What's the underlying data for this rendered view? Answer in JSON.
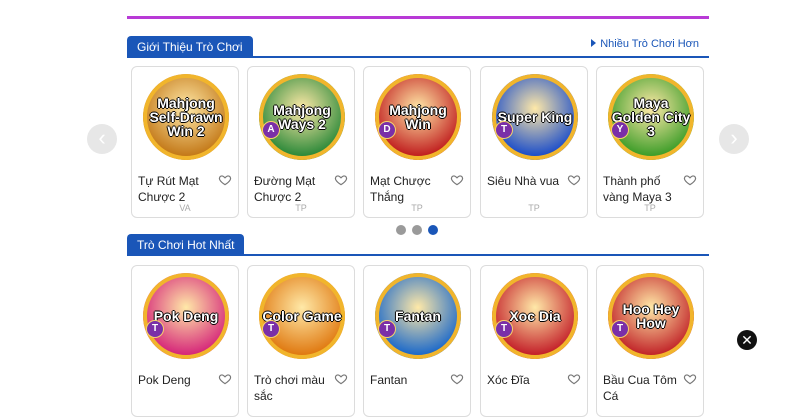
{
  "section1": {
    "title": "Giới Thiệu Trò Chơi",
    "more_label": "Nhiều Trò Chơi Hơn"
  },
  "section2": {
    "title": "Trò Chơi Hot Nhất"
  },
  "games_row1": [
    {
      "name": "Tự Rút Mạt Chược 2",
      "provider": "VA",
      "logo": "Mahjong Self-Drawn Win 2",
      "badge": "",
      "color": "#c47a1a"
    },
    {
      "name": "Đường Mạt Chược 2",
      "provider": "TP",
      "logo": "Mahjong Ways 2",
      "badge": "A",
      "color": "#2e8a3a"
    },
    {
      "name": "Mạt Chược Thắng",
      "provider": "TP",
      "logo": "Mahjong Win",
      "badge": "D",
      "color": "#c12020"
    },
    {
      "name": "Siêu Nhà vua",
      "provider": "TP",
      "logo": "Super King",
      "badge": "T",
      "color": "#1e4fc9"
    },
    {
      "name": "Thành phố vàng Maya 3",
      "provider": "TP",
      "logo": "Maya Golden City 3",
      "badge": "Y",
      "color": "#3f9e2a"
    }
  ],
  "games_row2": [
    {
      "name": "Pok Deng",
      "logo": "Pok Deng",
      "badge": "T",
      "color": "#d6287a"
    },
    {
      "name": "Trò chơi màu sắc",
      "logo": "Color Game",
      "badge": "T",
      "color": "#e07a12"
    },
    {
      "name": "Fantan",
      "logo": "Fantan",
      "badge": "T",
      "color": "#1e6ac9"
    },
    {
      "name": "Xóc Đĩa",
      "logo": "Xoc Dia",
      "badge": "T",
      "color": "#c4212a"
    },
    {
      "name": "Bầu Cua Tôm Cá",
      "logo": "Hoo Hey How",
      "badge": "T",
      "color": "#c2262a"
    }
  ],
  "carousel": {
    "pages": 3,
    "active_page": 3
  },
  "icons": {
    "prev": "chevron-left-icon",
    "next": "chevron-right-icon",
    "favorite": "heart-outline-icon",
    "close": "close-icon"
  },
  "colors": {
    "accent": "#1a56b8",
    "top_line": "#b83ad6"
  }
}
